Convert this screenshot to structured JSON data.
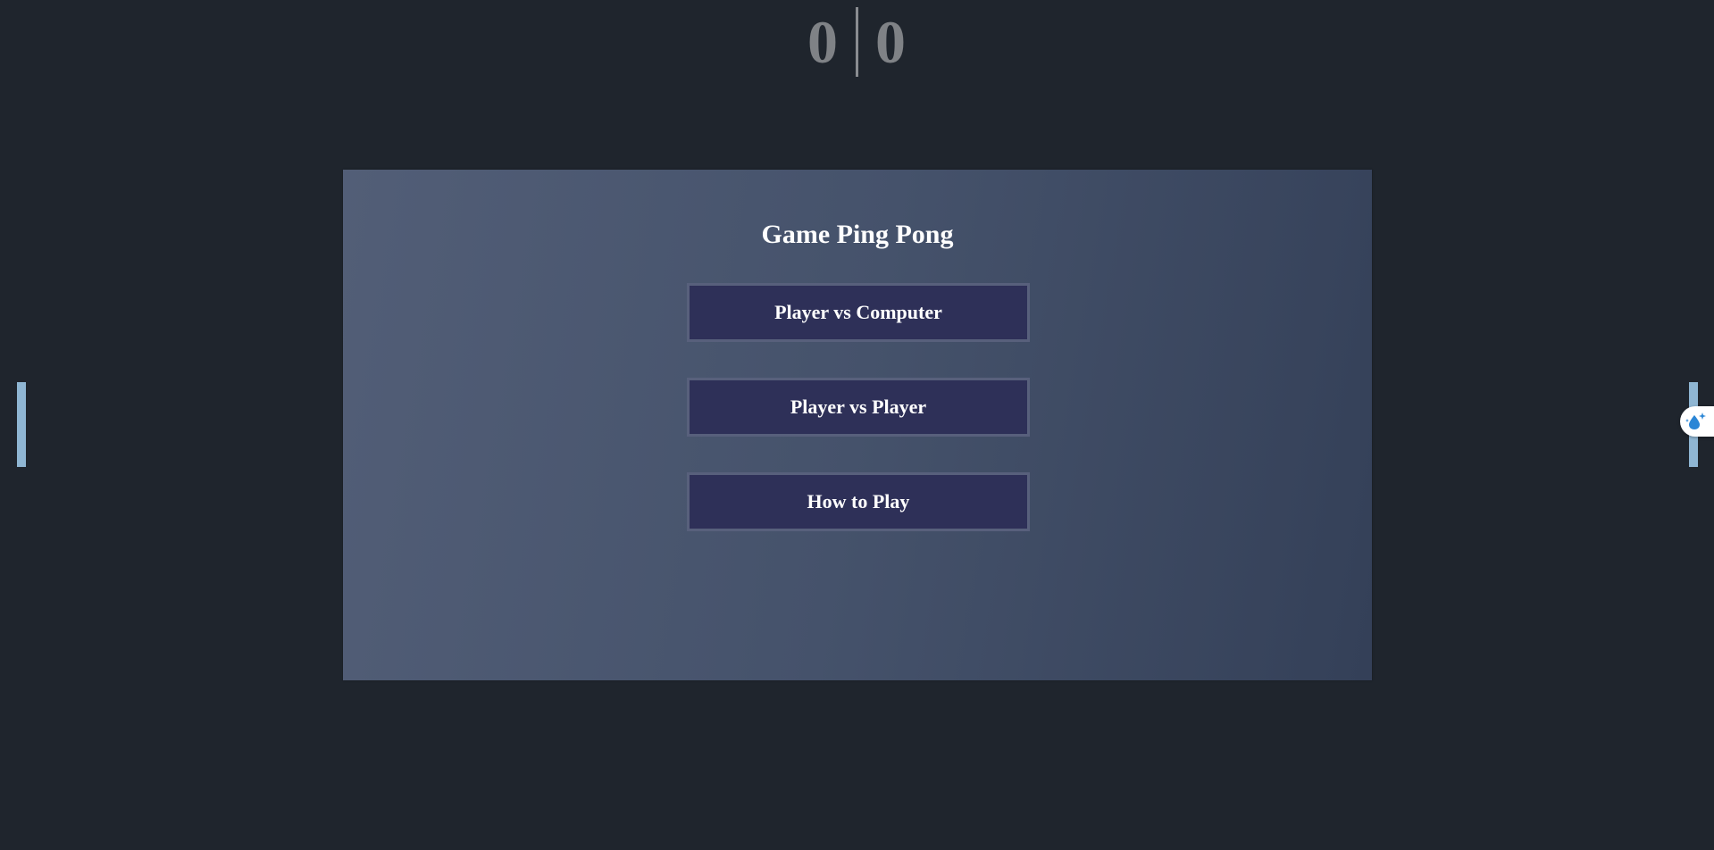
{
  "scoreboard": {
    "left_score": "0",
    "right_score": "0"
  },
  "menu": {
    "title": "Game Ping Pong",
    "buttons": [
      {
        "label": "Player vs Computer"
      },
      {
        "label": "Player vs Player"
      },
      {
        "label": "How to Play"
      }
    ]
  },
  "overlay": {
    "assist_icon": "water-drop-sparkle-icon"
  },
  "colors": {
    "background": "#1f252d",
    "paddle": "#8fb6d3",
    "button_fill": "#2e3058",
    "button_border": "#58607c",
    "score": "#7f8286"
  }
}
